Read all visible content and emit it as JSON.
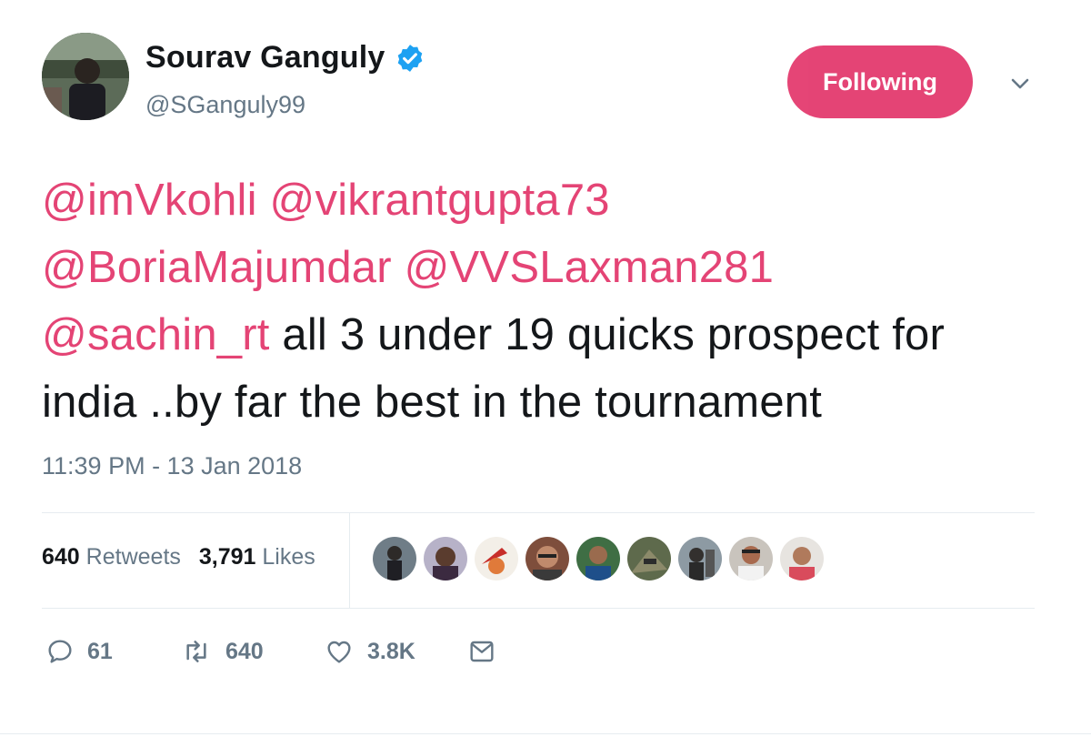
{
  "user": {
    "name": "Sourav Ganguly",
    "handle": "@SGanguly99",
    "verified": true
  },
  "follow_button": {
    "label": "Following"
  },
  "tweet": {
    "mentions_line1": [
      "@imVkohli",
      "@vikrantgupta73"
    ],
    "mentions_line2": [
      "@BoriaMajumdar",
      "@VVSLaxman281"
    ],
    "mention_line3": "@sachin_rt",
    "text_line3": " all 3 under 19 quicks prospect for",
    "text_line4": "india ..by far the best in the tournament"
  },
  "timestamp": "11:39 PM - 13 Jan 2018",
  "stats": {
    "retweets_count": "640",
    "retweets_label": "Retweets",
    "likes_count": "3,791",
    "likes_label": "Likes"
  },
  "actions": {
    "reply_count": "61",
    "retweet_count": "640",
    "like_count": "3.8K"
  },
  "colors": {
    "accent": "#e0245e",
    "verified": "#1da1f2",
    "muted": "#657786"
  },
  "icons": [
    "verified-badge-icon",
    "chevron-down-icon",
    "reply-icon",
    "retweet-icon",
    "heart-icon",
    "envelope-icon"
  ]
}
